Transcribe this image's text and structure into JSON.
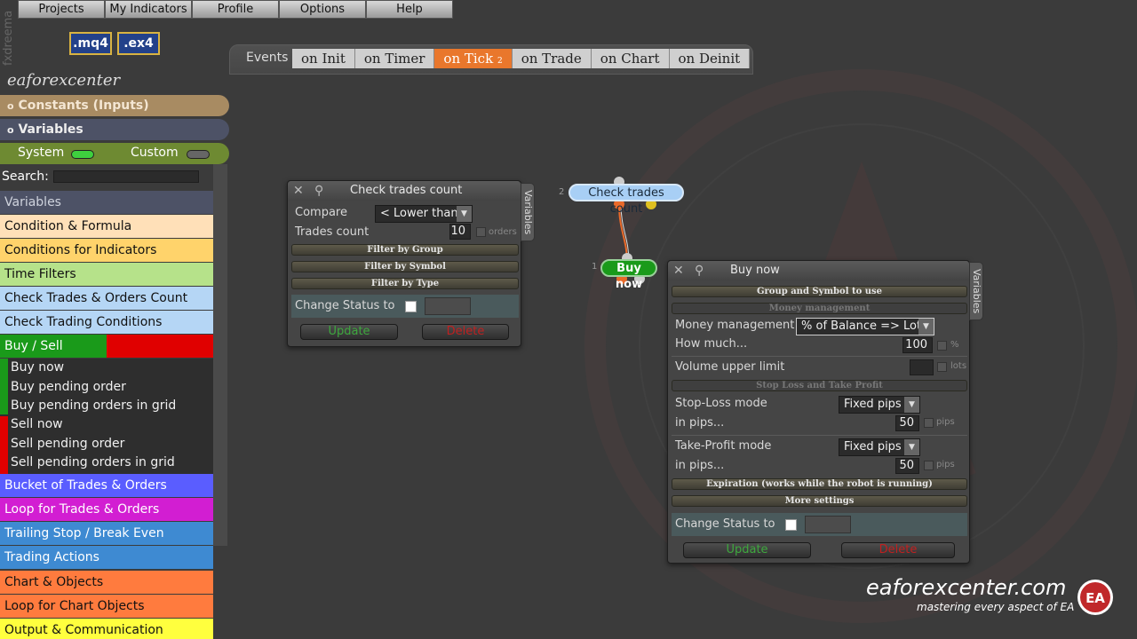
{
  "menu": [
    "Projects",
    "My Indicators",
    "Profile",
    "Options",
    "Help"
  ],
  "brand_vertical": "fxdreema",
  "ext_buttons": [
    ".mq4",
    ".ex4"
  ],
  "events": {
    "label": "Events",
    "tabs": [
      "on Init",
      "on Timer",
      "on Tick",
      "on Trade",
      "on Chart",
      "on Deinit"
    ],
    "active_tab": "on Tick",
    "active_badge": "2"
  },
  "sidebar": {
    "title": "eaforexcenter",
    "constants": "Constants (Inputs)",
    "variables": "Variables",
    "section_marker": "o",
    "toggle": {
      "system": "System",
      "custom": "Custom"
    },
    "search_label": "Search:",
    "categories": [
      {
        "label": "Variables",
        "color": "#4d5266",
        "text": "#cfd3dd"
      },
      {
        "label": "Condition & Formula",
        "color": "#ffe0b8"
      },
      {
        "label": "Conditions for Indicators",
        "color": "#ffd36b"
      },
      {
        "label": "Time Filters",
        "color": "#b6e28a"
      },
      {
        "label": "Check Trades & Orders Count",
        "color": "#b5d6f5"
      },
      {
        "label": "Check Trading Conditions",
        "color": "#b5d6f5"
      },
      {
        "label": "Buy / Sell",
        "color": "#1a9a1a",
        "text": "#fff"
      }
    ],
    "buy_sell_items": [
      "Buy now",
      "Buy pending order",
      "Buy pending orders in grid",
      "Sell now",
      "Sell pending order",
      "Sell pending orders in grid"
    ],
    "categories_after": [
      {
        "label": "Bucket of Trades & Orders",
        "color": "#5a5dff",
        "text": "#fff"
      },
      {
        "label": "Loop for Trades & Orders",
        "color": "#d21ed2",
        "text": "#fff"
      },
      {
        "label": "Trailing Stop / Break Even",
        "color": "#3e8ad2",
        "text": "#fff"
      },
      {
        "label": "Trading Actions",
        "color": "#3e8ad2",
        "text": "#fff"
      },
      {
        "label": "Chart & Objects",
        "color": "#ff7b3e"
      },
      {
        "label": "Loop for Chart Objects",
        "color": "#ff7b3e"
      },
      {
        "label": "Output & Communication",
        "color": "#ffff3e"
      }
    ]
  },
  "node_check": {
    "title": "Check trades count",
    "side_tab": "Variables",
    "compare_label": "Compare",
    "compare_value": "< Lower than",
    "trades_label": "Trades count",
    "trades_value": "10",
    "trades_unit": "orders",
    "filters": [
      "Filter by Group",
      "Filter by Symbol",
      "Filter by Type"
    ],
    "status_label": "Change Status to",
    "update": "Update",
    "delete": "Delete"
  },
  "node_buy": {
    "title": "Buy now",
    "side_tab": "Variables",
    "group_bar": "Group and Symbol to use",
    "mm_header": "Money management",
    "mm_label": "Money management",
    "mm_value": "% of Balance => Lots",
    "how_much_label": "How much...",
    "how_much_value": "100",
    "how_much_unit": "%",
    "volume_label": "Volume upper limit",
    "volume_unit": "lots",
    "sltp_header": "Stop Loss and Take Profit",
    "sl_mode_label": "Stop-Loss mode",
    "sl_mode_value": "Fixed pips",
    "sl_pips_label": "in pips...",
    "sl_pips_value": "50",
    "sl_unit": "pips",
    "tp_mode_label": "Take-Profit mode",
    "tp_mode_value": "Fixed pips",
    "tp_pips_label": "in pips...",
    "tp_pips_value": "50",
    "tp_unit": "pips",
    "expiration_bar": "Expiration (works while the robot is running)",
    "more_bar": "More settings",
    "status_label": "Change Status to",
    "update": "Update",
    "delete": "Delete"
  },
  "canvas_nodes": [
    {
      "num": "2",
      "label": "Check trades count"
    },
    {
      "num": "1",
      "label": "Buy now"
    }
  ],
  "logo": {
    "text": "eaforexcenter.com",
    "tagline": "mastering every aspect of EA",
    "badge": "EA"
  }
}
